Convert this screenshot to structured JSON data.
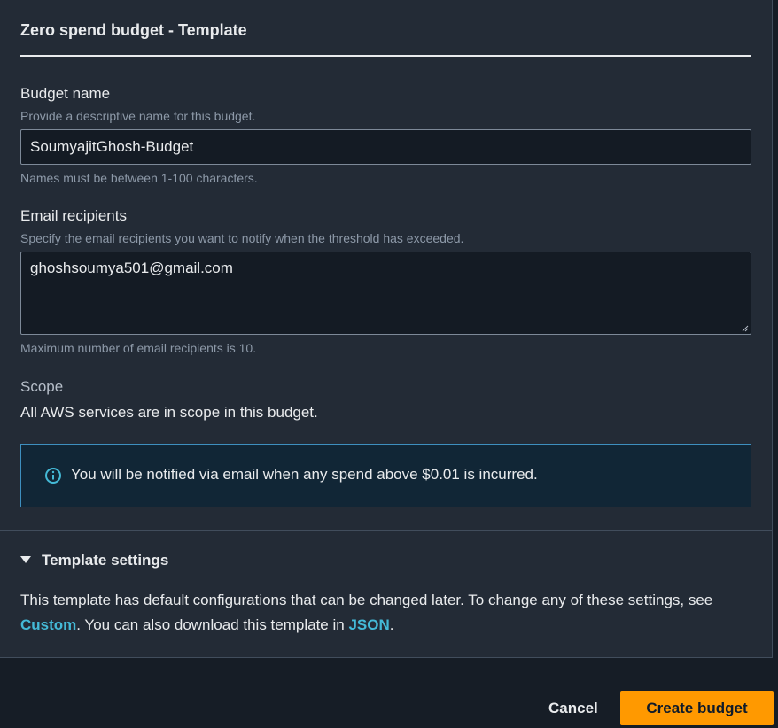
{
  "header": {
    "title": "Zero spend budget - Template"
  },
  "budget_name": {
    "label": "Budget name",
    "description": "Provide a descriptive name for this budget.",
    "value": "SoumyajitGhosh-Budget",
    "constraint": "Names must be between 1-100 characters."
  },
  "email": {
    "label": "Email recipients",
    "description": "Specify the email recipients you want to notify when the threshold has exceeded.",
    "value": "ghoshsoumya501@gmail.com",
    "constraint": "Maximum number of email recipients is 10."
  },
  "scope": {
    "label": "Scope",
    "text": "All AWS services are in scope in this budget."
  },
  "info": {
    "icon": "info-icon",
    "text": "You will be notified via email when any spend above $0.01 is incurred."
  },
  "template_settings": {
    "title": "Template settings",
    "text_before_custom": "This template has default configurations that can be changed later. To change any of these settings, see ",
    "custom_link": "Custom",
    "text_middle": ". You can also download this template in ",
    "json_link": "JSON",
    "text_end": "."
  },
  "footer": {
    "cancel_label": "Cancel",
    "create_label": "Create budget"
  },
  "colors": {
    "accent": "#ff9900",
    "link": "#44b9d6",
    "info_border": "#3e8fbf"
  }
}
